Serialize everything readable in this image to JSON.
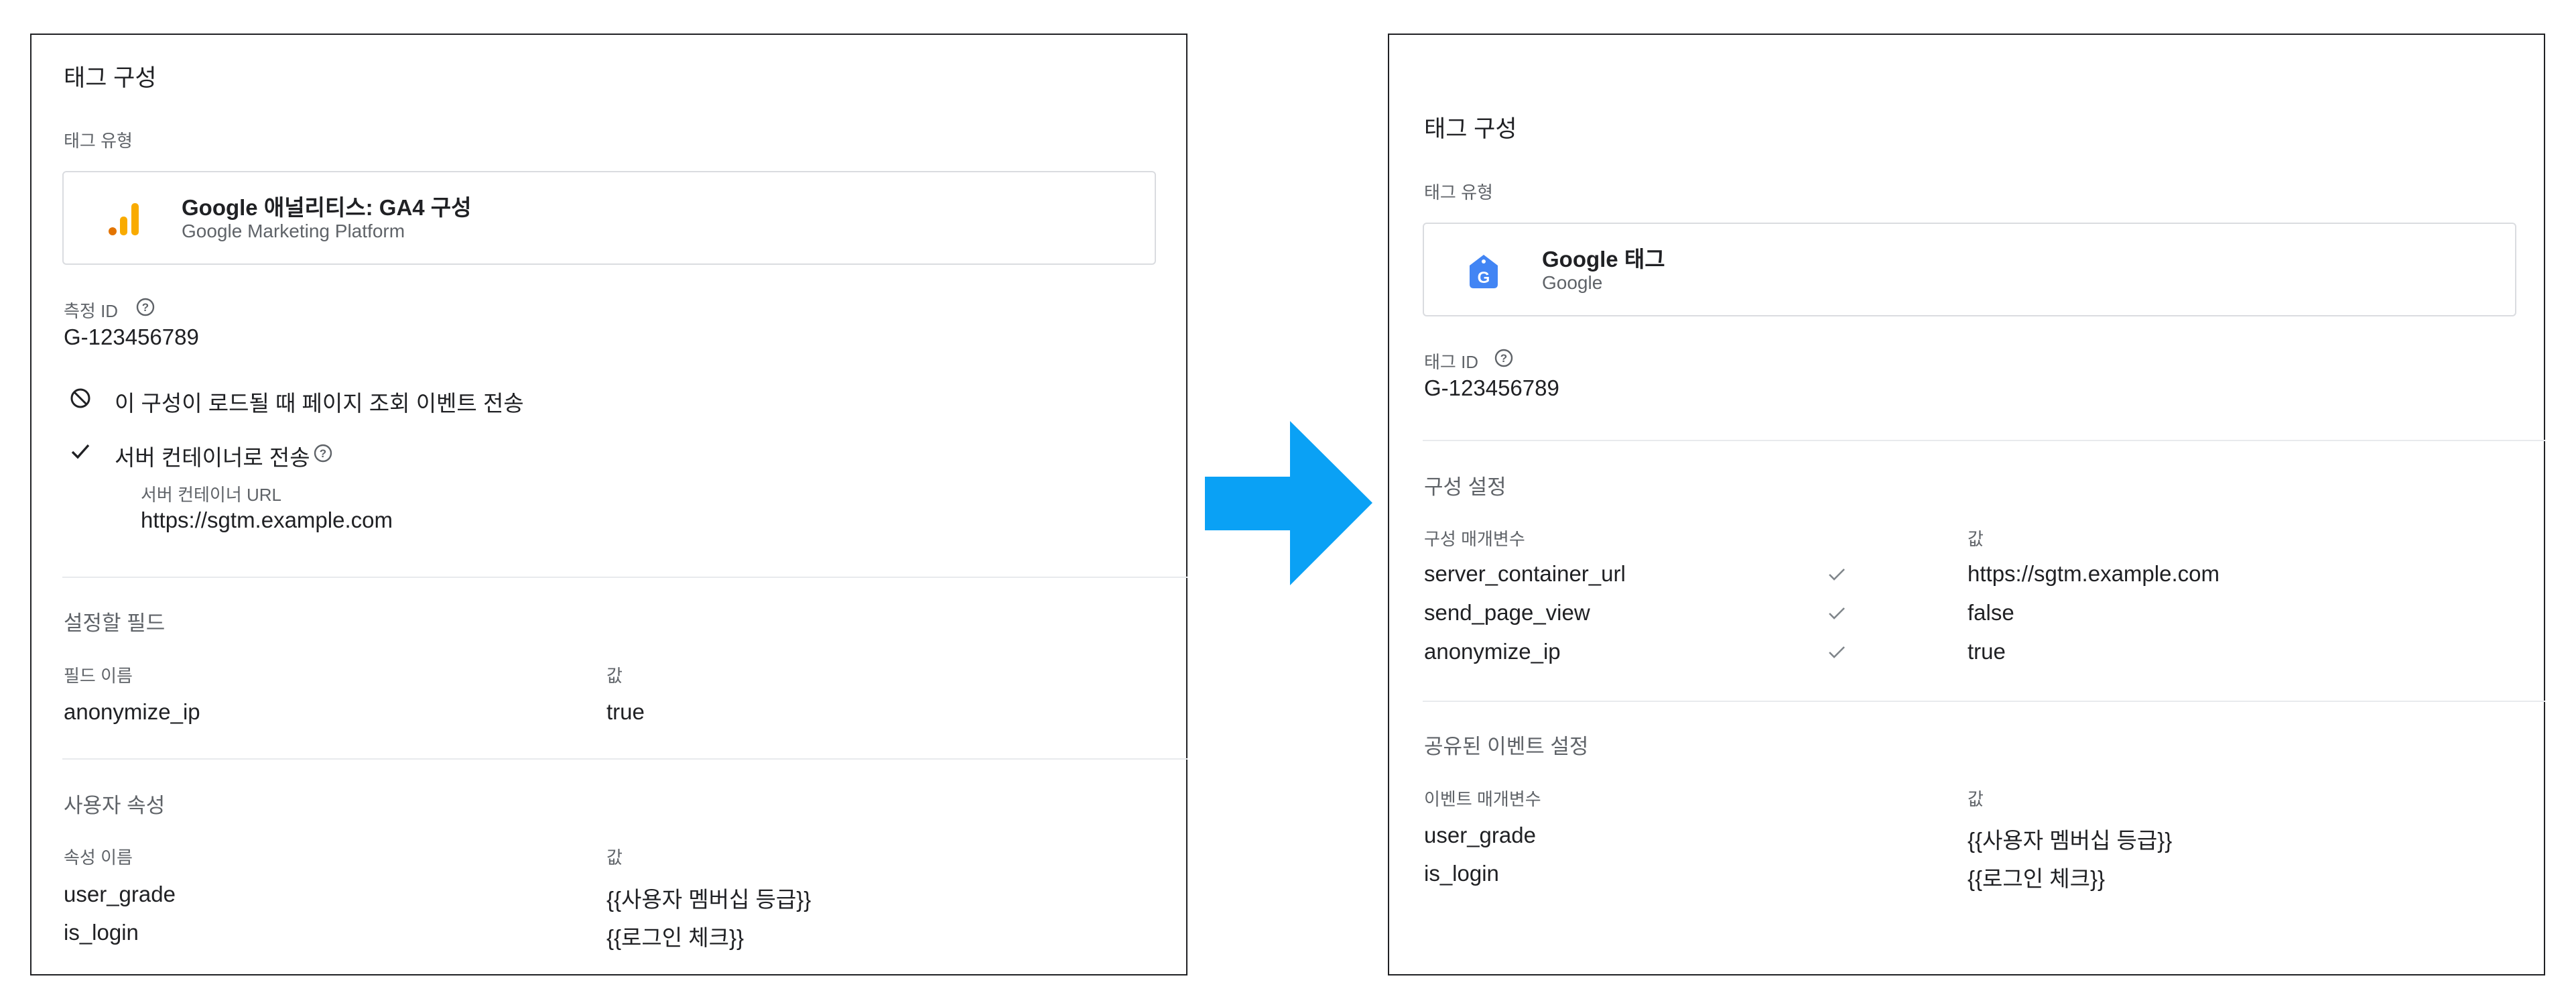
{
  "left": {
    "title": "태그 구성",
    "tag_type_label": "태그 유형",
    "tag_card": {
      "title": "Google 애널리티스: GA4 구성",
      "subtitle": "Google Marketing Platform",
      "icon": "analytics-icon"
    },
    "id_label": "측정 ID",
    "id_value": "G-123456789",
    "option_pageview": "이 구성이 로드될 때 페이지 조회 이벤트 전송",
    "option_server": "서버 컨테이너로 전송",
    "server_url_label": "서버 컨테이너 URL",
    "server_url_value": "https://sgtm.example.com",
    "fields_section": {
      "title": "설정할 필드",
      "col_name": "필드 이름",
      "col_value": "값",
      "rows": [
        {
          "name": "anonymize_ip",
          "value": "true"
        }
      ]
    },
    "user_props_section": {
      "title": "사용자 속성",
      "col_name": "속성 이름",
      "col_value": "값",
      "rows": [
        {
          "name": "user_grade",
          "value": "{{사용자 멤버십 등급}}"
        },
        {
          "name": "is_login",
          "value": "{{로그인 체크}}"
        }
      ]
    }
  },
  "right": {
    "title": "태그 구성",
    "tag_type_label": "태그 유형",
    "tag_card": {
      "title": "Google 태그",
      "subtitle": "Google",
      "icon": "google-tag-icon"
    },
    "id_label": "태그 ID",
    "id_value": "G-123456789",
    "config_section": {
      "title": "구성 설정",
      "col_name": "구성 매개변수",
      "col_value": "값",
      "rows": [
        {
          "name": "server_container_url",
          "value": "https://sgtm.example.com"
        },
        {
          "name": "send_page_view",
          "value": "false"
        },
        {
          "name": "anonymize_ip",
          "value": "true"
        }
      ]
    },
    "event_section": {
      "title": "공유된 이벤트 설정",
      "col_name": "이벤트 매개변수",
      "col_value": "값",
      "rows": [
        {
          "name": "user_grade",
          "value": "{{사용자 멤버십 등급}}"
        },
        {
          "name": "is_login",
          "value": "{{로그인 체크}}"
        }
      ]
    }
  },
  "colors": {
    "arrow": "#0aa1f5",
    "ga_orange": "#f9ab00",
    "ga_dark_orange": "#e37400",
    "gtag_blue": "#4285f4"
  }
}
